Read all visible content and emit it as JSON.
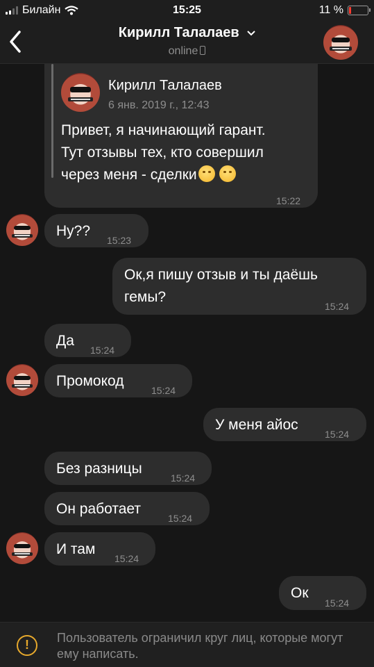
{
  "status_bar": {
    "carrier": "Билайн",
    "time": "15:25",
    "battery": "11 %"
  },
  "header": {
    "title": "Кирилл Талалаев",
    "status": "online"
  },
  "quote": {
    "author": "Кирилл Талалаев",
    "date": "6 янв. 2019 г., 12:43",
    "lines": [
      "Привет, я начинающий гарант.",
      "Тут отзывы тех, кто совершил",
      "через меня - сделки"
    ],
    "time": "15:22"
  },
  "messages": [
    {
      "text": "Ну??",
      "time": "15:23"
    },
    {
      "lines": [
        "Ок,я пишу отзыв и ты даёшь",
        "гемы?"
      ],
      "time": "15:24"
    },
    {
      "text": "Да",
      "time": "15:24"
    },
    {
      "text": "Промокод",
      "time": "15:24"
    },
    {
      "text": "У меня айос",
      "time": "15:24"
    },
    {
      "text": "Без разницы",
      "time": "15:24"
    },
    {
      "text": "Он работает",
      "time": "15:24"
    },
    {
      "text": "И там",
      "time": "15:24"
    },
    {
      "text": "Ок",
      "time": "15:24"
    }
  ],
  "notice": {
    "text": "Пользователь ограничил круг лиц, которые могут ему написать."
  },
  "icons": [
    "back-icon",
    "chevron-down-icon",
    "phone-icon",
    "warning-icon",
    "signal-icon",
    "wifi-icon",
    "battery-icon"
  ]
}
